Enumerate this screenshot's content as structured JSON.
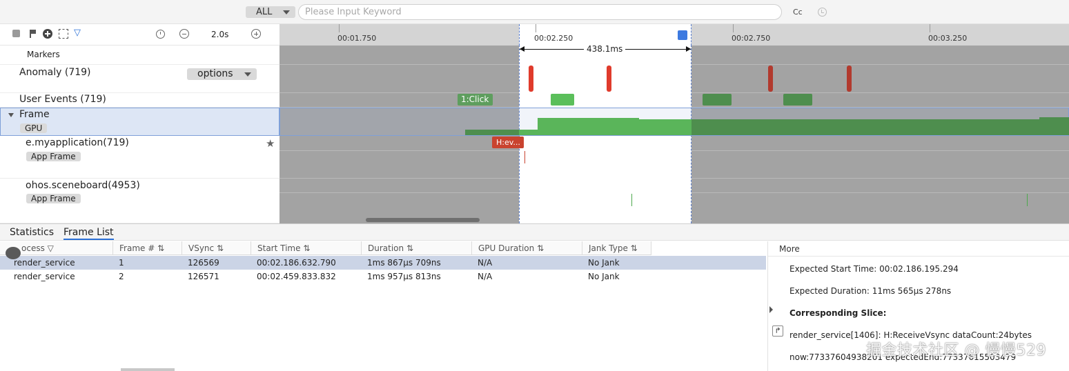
{
  "search": {
    "filter_value": "ALL",
    "placeholder": "Please Input Keyword",
    "case_toggle": "Cc"
  },
  "toolbar": {
    "scale": "2.0s"
  },
  "timeline": {
    "ticks": [
      "00:01.750",
      "00:02.250",
      "00:02.750",
      "00:03.250"
    ],
    "selection_duration": "438.1ms"
  },
  "tracks": {
    "markers": "Markers",
    "anomaly": "Anomaly (719)",
    "options": "options",
    "user_events": "User Events (719)",
    "frame": "Frame",
    "frame_tag": "GPU",
    "app1": "e.myapplication(719)",
    "app1_tag": "App Frame",
    "app2": "ohos.sceneboard(4953)",
    "app2_tag": "App Frame",
    "click_event": "1:Click",
    "slice_label": "H:ev..."
  },
  "bottom": {
    "tabs": [
      "Statistics",
      "Frame List"
    ],
    "columns": [
      "ocess",
      "Frame #",
      "VSync",
      "Start Time",
      "Duration",
      "GPU Duration",
      "Jank Type"
    ],
    "rows": [
      [
        "render_service",
        "1",
        "126569",
        "00:02.186.632.790",
        "1ms 867μs 709ns",
        "N/A",
        "No Jank"
      ],
      [
        "render_service",
        "2",
        "126571",
        "00:02.459.833.832",
        "1ms 957μs 813ns",
        "N/A",
        "No Jank"
      ]
    ],
    "more": {
      "title": "More",
      "expected_start": "Expected Start Time: 00:02.186.195.294",
      "expected_duration": "Expected Duration: 11ms 565μs 278ns",
      "corresponding": "Corresponding Slice:",
      "slice": "render_service[1406]: H:ReceiveVsync dataCount:24bytes",
      "now": "now:77337604938201 expectedEnd:77337615503479"
    }
  },
  "watermark": "掘金技术社区 @ 慢慢529"
}
